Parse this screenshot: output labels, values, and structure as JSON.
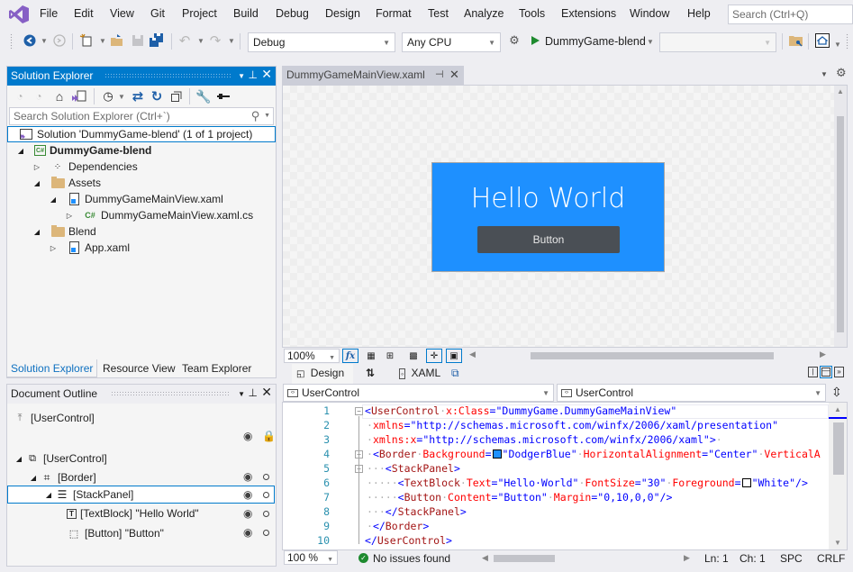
{
  "menu": {
    "items": [
      "File",
      "Edit",
      "View",
      "Git",
      "Project",
      "Build",
      "Debug",
      "Design",
      "Format",
      "Test",
      "Analyze",
      "Tools",
      "Extensions",
      "Window",
      "Help"
    ],
    "search_placeholder": "Search (Ctrl+Q)"
  },
  "toolbar": {
    "config": "Debug",
    "platform": "Any CPU",
    "start_target": "DummyGame-blend",
    "extra_combo": ""
  },
  "solution_explorer": {
    "title": "Solution Explorer",
    "search_placeholder": "Search Solution Explorer (Ctrl+`)",
    "solution": "Solution 'DummyGame-blend' (1 of 1 project)",
    "tree": [
      {
        "label": "DummyGame-blend",
        "icon": "csharp-project-icon",
        "expander": "expanded"
      },
      {
        "label": "Dependencies",
        "icon": "dependencies-icon",
        "expander": "collapsed"
      },
      {
        "label": "Assets",
        "icon": "folder-icon",
        "expander": "expanded"
      },
      {
        "label": "DummyGameMainView.xaml",
        "icon": "xaml-file-icon",
        "expander": "expanded"
      },
      {
        "label": "DummyGameMainView.xaml.cs",
        "icon": "csharp-file-icon",
        "expander": "collapsed"
      },
      {
        "label": "Blend",
        "icon": "folder-icon",
        "expander": "expanded"
      },
      {
        "label": "App.xaml",
        "icon": "xaml-file-icon",
        "expander": "collapsed"
      }
    ],
    "tabs": [
      "Solution Explorer",
      "Resource View",
      "Team Explorer"
    ],
    "active_tab": "Solution Explorer"
  },
  "document_outline": {
    "title": "Document Outline",
    "scope": "[UserControl]",
    "tree": [
      {
        "label": "[UserControl]",
        "icon": "usercontrol-icon"
      },
      {
        "label": "[Border]",
        "icon": "border-icon"
      },
      {
        "label": "[StackPanel]",
        "icon": "stackpanel-icon",
        "selected": true
      },
      {
        "label": "[TextBlock] \"Hello World\"",
        "icon": "textblock-icon"
      },
      {
        "label": "[Button] \"Button\"",
        "icon": "button-icon"
      }
    ]
  },
  "document": {
    "tab": "DummyGameMainView.xaml"
  },
  "designer": {
    "hello_text": "Hello World",
    "button_text": "Button",
    "background_color": "#1E90FF",
    "zoom": "100%",
    "design_tab": "Design",
    "xaml_tab": "XAML"
  },
  "xaml_editor": {
    "left_combo": "UserControl",
    "right_combo": "UserControl",
    "line_numbers": [
      "1",
      "2",
      "3",
      "4",
      "5",
      "6",
      "7",
      "8",
      "9",
      "10"
    ],
    "lines": [
      "<UserControl x:Class=\"DummyGame.DummyGameMainView\"",
      "  xmlns=\"http://schemas.microsoft.com/winfx/2006/xaml/presentation\"",
      "  xmlns:x=\"http://schemas.microsoft.com/winfx/2006/xaml\">",
      "  <Border Background=\"DodgerBlue\" HorizontalAlignment=\"Center\" VerticalA",
      "    <StackPanel>",
      "      <TextBlock Text=\"Hello World\" FontSize=\"30\" Foreground=\"White\"/>",
      "      <Button Content=\"Button\" Margin=\"0,10,0,0\"/>",
      "    </StackPanel>",
      "  </Border>",
      "</UserControl>"
    ]
  },
  "status": {
    "zoom": "100 %",
    "issues": "No issues found",
    "line": "Ln: 1",
    "char": "Ch: 1",
    "whitespace": "SPC",
    "line_ending": "CRLF"
  }
}
